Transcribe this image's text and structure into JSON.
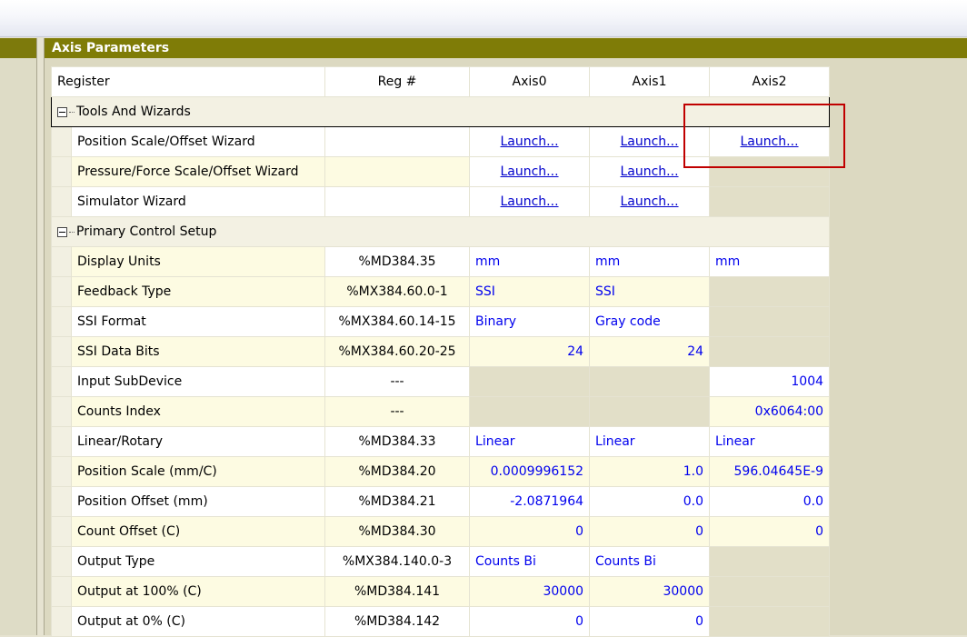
{
  "panel": {
    "title": "Axis Parameters"
  },
  "columns": {
    "register": "Register",
    "reg_num": "Reg #",
    "axis0": "Axis0",
    "axis1": "Axis1",
    "axis2": "Axis2"
  },
  "groups": {
    "tools": {
      "label": "Tools And Wizards",
      "rows": [
        {
          "name": "Position Scale/Offset Wizard",
          "reg": "",
          "axis0": "Launch...",
          "axis1": "Launch...",
          "axis2": "Launch..."
        },
        {
          "name": "Pressure/Force Scale/Offset Wizard",
          "reg": "",
          "axis0": "Launch...",
          "axis1": "Launch...",
          "axis2": ""
        },
        {
          "name": "Simulator Wizard",
          "reg": "",
          "axis0": "Launch...",
          "axis1": "Launch...",
          "axis2": ""
        }
      ]
    },
    "primary": {
      "label": "Primary Control Setup",
      "rows": [
        {
          "name": "Display Units",
          "reg": "%MD384.35",
          "axis0": "mm",
          "axis1": "mm",
          "axis2": "mm"
        },
        {
          "name": "Feedback Type",
          "reg": "%MX384.60.0-1",
          "axis0": "SSI",
          "axis1": "SSI",
          "axis2": ""
        },
        {
          "name": "SSI Format",
          "reg": "%MX384.60.14-15",
          "axis0": "Binary",
          "axis1": "Gray code",
          "axis2": ""
        },
        {
          "name": "SSI Data Bits",
          "reg": "%MX384.60.20-25",
          "axis0": "24",
          "axis1": "24",
          "axis2": ""
        },
        {
          "name": "Input SubDevice",
          "reg": "---",
          "axis0": "",
          "axis1": "",
          "axis2": "1004"
        },
        {
          "name": "Counts Index",
          "reg": "---",
          "axis0": "",
          "axis1": "",
          "axis2": "0x6064:00"
        },
        {
          "name": "Linear/Rotary",
          "reg": "%MD384.33",
          "axis0": "Linear",
          "axis1": "Linear",
          "axis2": "Linear"
        },
        {
          "name": "Position Scale (mm/C)",
          "reg": "%MD384.20",
          "axis0": "0.0009996152",
          "axis1": "1.0",
          "axis2": "596.04645E-9"
        },
        {
          "name": "Position Offset (mm)",
          "reg": "%MD384.21",
          "axis0": "-2.0871964",
          "axis1": "0.0",
          "axis2": "0.0"
        },
        {
          "name": "Count Offset (C)",
          "reg": "%MD384.30",
          "axis0": "0",
          "axis1": "0",
          "axis2": "0"
        },
        {
          "name": "Output Type",
          "reg": "%MX384.140.0-3",
          "axis0": "Counts Bi",
          "axis1": "Counts Bi",
          "axis2": ""
        },
        {
          "name": "Output at 100% (C)",
          "reg": "%MD384.141",
          "axis0": "30000",
          "axis1": "30000",
          "axis2": ""
        },
        {
          "name": "Output at 0% (C)",
          "reg": "%MD384.142",
          "axis0": "0",
          "axis1": "0",
          "axis2": ""
        }
      ]
    }
  },
  "colors": {
    "panel_header": "#7f7c07",
    "highlight": "#c00000",
    "value_text": "#0000ee"
  }
}
